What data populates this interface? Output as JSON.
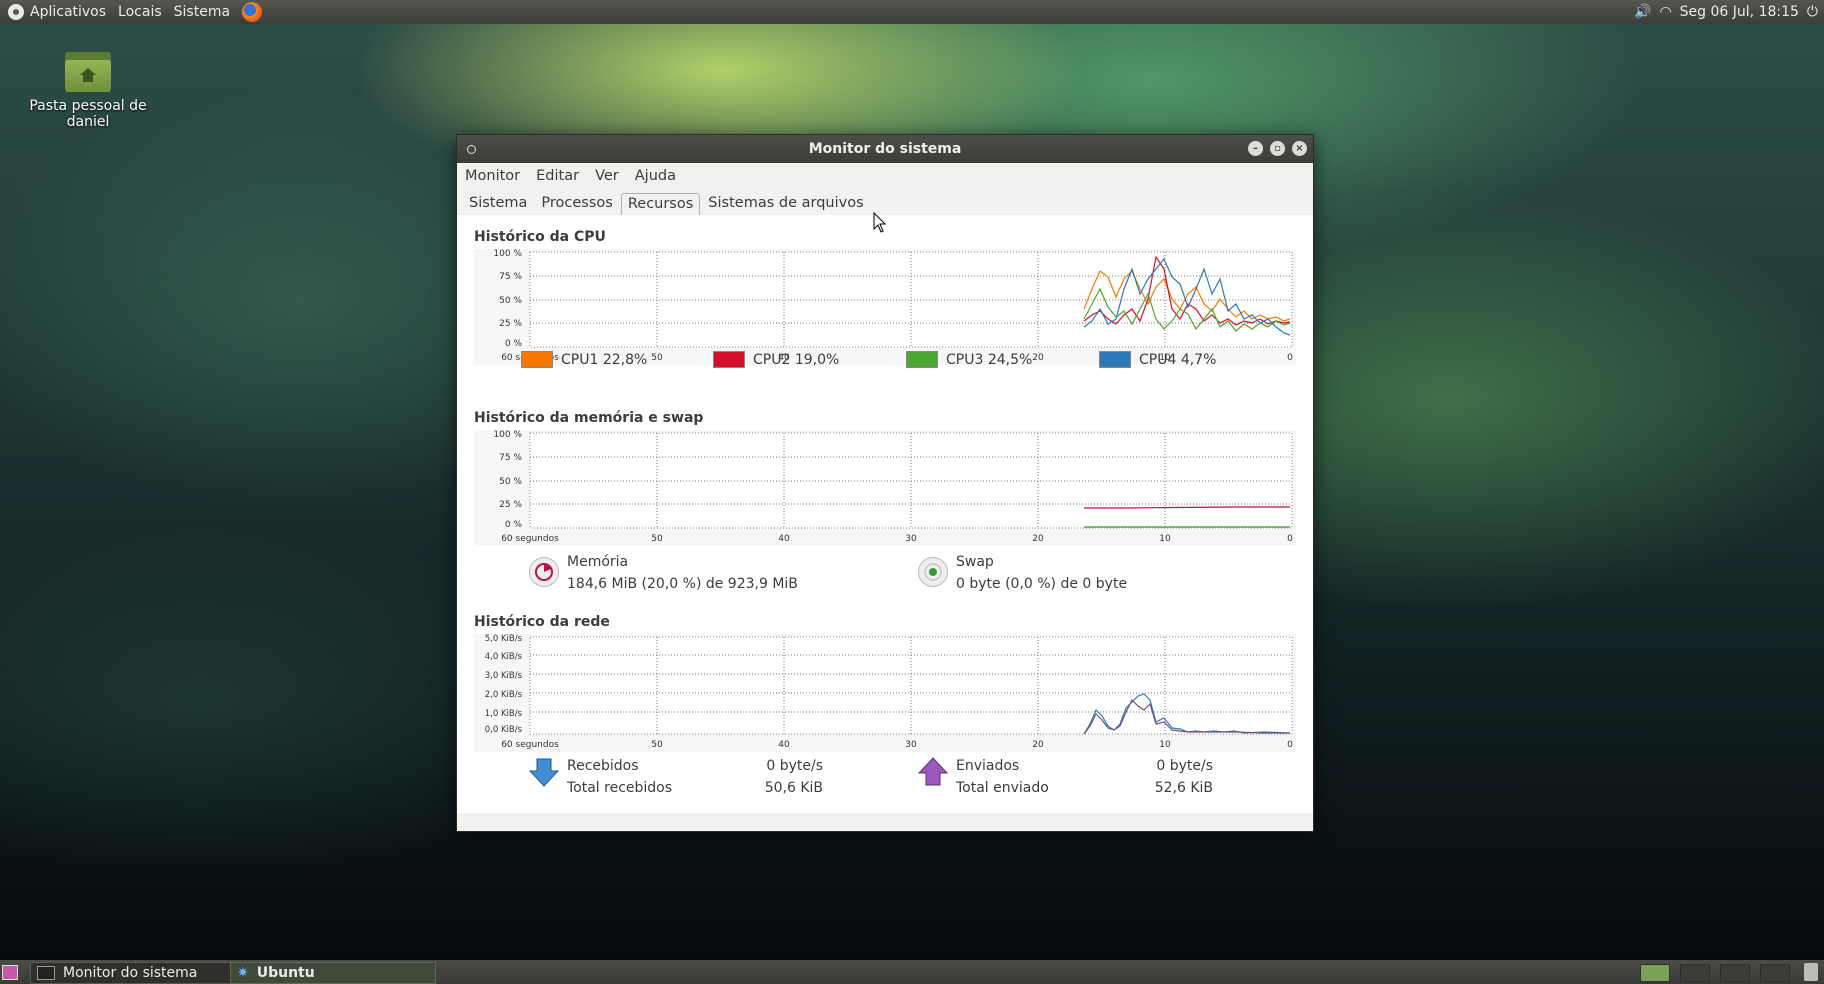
{
  "top_panel": {
    "menus": [
      "Aplicativos",
      "Locais",
      "Sistema"
    ],
    "clock": "Seg 06 Jul, 18:15"
  },
  "desktop": {
    "home_icon_label": "Pasta pessoal de daniel"
  },
  "window": {
    "title": "Monitor do sistema",
    "menubar": [
      "Monitor",
      "Editar",
      "Ver",
      "Ajuda"
    ],
    "tabs": [
      "Sistema",
      "Processos",
      "Recursos",
      "Sistemas de arquivos"
    ],
    "active_tab": "Recursos",
    "cpu": {
      "title": "Histórico da CPU",
      "y_ticks": [
        "100 %",
        "75 %",
        "50 %",
        "25 %",
        "0 %"
      ],
      "x_ticks": [
        "60 segundos",
        "50",
        "40",
        "30",
        "20",
        "10",
        "0"
      ],
      "legend": [
        {
          "name": "CPU1",
          "value": "22,8%",
          "color": "#f57900"
        },
        {
          "name": "CPU2",
          "value": "19,0%",
          "color": "#d3102a"
        },
        {
          "name": "CPU3",
          "value": "24,5%",
          "color": "#4aa832"
        },
        {
          "name": "CPU4",
          "value": "4,7%",
          "color": "#2d79b8"
        }
      ]
    },
    "memory": {
      "title": "Histórico da memória e swap",
      "y_ticks": [
        "100 %",
        "75 %",
        "50 %",
        "25 %",
        "0 %"
      ],
      "x_ticks": [
        "60 segundos",
        "50",
        "40",
        "30",
        "20",
        "10",
        "0"
      ],
      "mem_label": "Memória",
      "mem_value": "184,6 MiB (20,0 %) de 923,9 MiB",
      "swap_label": "Swap",
      "swap_value": "0 byte (0,0 %) de 0 byte",
      "mem_color": "#b4134c",
      "swap_color": "#3b9a2f"
    },
    "network": {
      "title": "Histórico da rede",
      "y_ticks": [
        "5,0 KiB/s",
        "4,0 KiB/s",
        "3,0 KiB/s",
        "2,0 KiB/s",
        "1,0 KiB/s",
        "0,0 KiB/s"
      ],
      "x_ticks": [
        "60 segundos",
        "50",
        "40",
        "30",
        "20",
        "10",
        "0"
      ],
      "received_label": "Recebidos",
      "received_rate": "0 byte/s",
      "total_received_label": "Total recebidos",
      "total_received": "50,6 KiB",
      "sent_label": "Enviados",
      "sent_rate": "0 byte/s",
      "total_sent_label": "Total enviado",
      "total_sent": "52,6 KiB"
    }
  },
  "taskbar": {
    "tasks": [
      "Monitor do sistema",
      "Ubuntu"
    ]
  }
}
